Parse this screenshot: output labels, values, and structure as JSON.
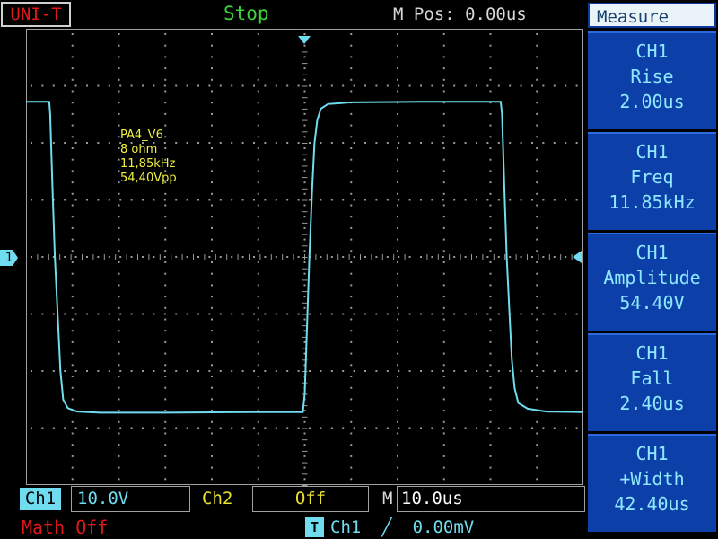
{
  "header": {
    "brand": "UNI-T",
    "run_state": "Stop",
    "m_pos": "M Pos: 0.00us"
  },
  "markers": {
    "channel1": "1"
  },
  "annotation": {
    "lines": [
      "PA4_V6",
      "8 ohm",
      "11,85kHz",
      "54,40Vpp"
    ]
  },
  "measure_panel": {
    "title": "Measure",
    "cards": [
      {
        "channel": "CH1",
        "name": "Rise",
        "value": "2.00us"
      },
      {
        "channel": "CH1",
        "name": "Freq",
        "value": "11.85kHz"
      },
      {
        "channel": "CH1",
        "name": "Amplitude",
        "value": "54.40V"
      },
      {
        "channel": "CH1",
        "name": "Fall",
        "value": "2.40us"
      },
      {
        "channel": "CH1",
        "name": "+Width",
        "value": "42.40us"
      }
    ]
  },
  "status": {
    "ch1_label": "Ch1",
    "ch1_vdiv": "10.0V",
    "ch2_label": "Ch2",
    "ch2_state": "Off",
    "timebase_label": "M",
    "timebase": "10.0us",
    "math": "Math Off",
    "trigger_badge": "T",
    "trigger_source": "Ch1",
    "trigger_slope": "╱",
    "trigger_level": "0.00mV"
  },
  "colors": {
    "trace": "#6fdcf0",
    "grid_dots": "#9a9a9a",
    "annotation": "#f0f040",
    "panel": "#0d3fa8"
  },
  "waveform": {
    "x_unit": "us",
    "y_unit": "V",
    "x_range": [
      -60,
      60
    ],
    "y_range": [
      -40,
      40
    ],
    "points": [
      [
        -60,
        27.2
      ],
      [
        -55.0,
        27.2
      ],
      [
        -54.8,
        25.0
      ],
      [
        -54.3,
        12.0
      ],
      [
        -53.8,
        0.0
      ],
      [
        -53.2,
        -10.0
      ],
      [
        -52.6,
        -20.0
      ],
      [
        -52.0,
        -25.0
      ],
      [
        -51.0,
        -26.5
      ],
      [
        -49.0,
        -27.1
      ],
      [
        -44.0,
        -27.3
      ],
      [
        -30.0,
        -27.3
      ],
      [
        -12.0,
        -27.2
      ],
      [
        -0.4,
        -27.2
      ],
      [
        0.0,
        -24.0
      ],
      [
        0.5,
        -12.0
      ],
      [
        1.0,
        0.0
      ],
      [
        1.6,
        12.0
      ],
      [
        2.1,
        20.0
      ],
      [
        2.7,
        24.0
      ],
      [
        3.5,
        26.0
      ],
      [
        5.0,
        26.8
      ],
      [
        10.0,
        27.1
      ],
      [
        25.0,
        27.2
      ],
      [
        42.2,
        27.2
      ],
      [
        42.5,
        25.0
      ],
      [
        43.0,
        12.0
      ],
      [
        43.5,
        0.0
      ],
      [
        44.1,
        -10.0
      ],
      [
        44.6,
        -18.0
      ],
      [
        45.2,
        -23.0
      ],
      [
        46.0,
        -25.6
      ],
      [
        48.0,
        -26.6
      ],
      [
        52.0,
        -27.1
      ],
      [
        60,
        -27.2
      ]
    ]
  }
}
